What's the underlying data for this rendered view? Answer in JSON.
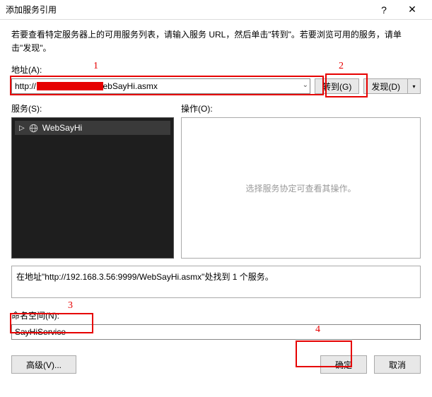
{
  "window": {
    "title": "添加服务引用",
    "help_icon": "?",
    "close_icon": "✕"
  },
  "intro": "若要查看特定服务器上的可用服务列表，请输入服务 URL，然后单击\"转到\"。若要浏览可用的服务，请单击\"发现\"。",
  "address": {
    "label": "地址(A):",
    "value": "http://               :9999/WebSayHi.asmx"
  },
  "buttons": {
    "go": "转到(G)",
    "discover": "发现(D)",
    "advanced": "高级(V)...",
    "ok": "确定",
    "cancel": "取消"
  },
  "services": {
    "label": "服务(S):",
    "items": [
      {
        "name": "WebSayHi"
      }
    ]
  },
  "operations": {
    "label": "操作(O):",
    "placeholder": "选择服务协定可查看其操作。"
  },
  "status": {
    "text": "在地址\"http://192.168.3.56:9999/WebSayHi.asmx\"处找到 1 个服务。"
  },
  "namespace": {
    "label": "命名空间(N):",
    "value": "SayHiService"
  },
  "annotations": {
    "a1": "1",
    "a2": "2",
    "a3": "3",
    "a4": "4"
  }
}
